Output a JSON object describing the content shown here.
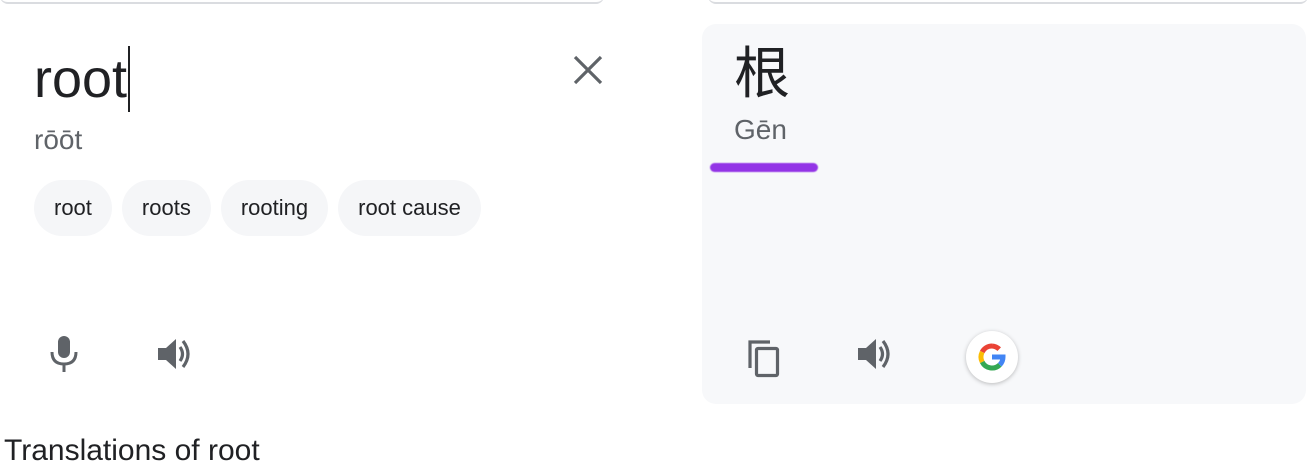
{
  "source": {
    "text": "root",
    "romanization": "rōōt",
    "suggestions": [
      "root",
      "roots",
      "rooting",
      "root cause"
    ],
    "icons": {
      "clear": "close-icon",
      "mic": "microphone-icon",
      "speak": "speaker-icon"
    }
  },
  "target": {
    "text": "根",
    "romanization": "Gēn",
    "underline_color": "#9334e6",
    "icons": {
      "copy": "copy-icon",
      "speak": "speaker-icon",
      "search": "google-icon"
    }
  },
  "translations_heading": "Translations of root"
}
